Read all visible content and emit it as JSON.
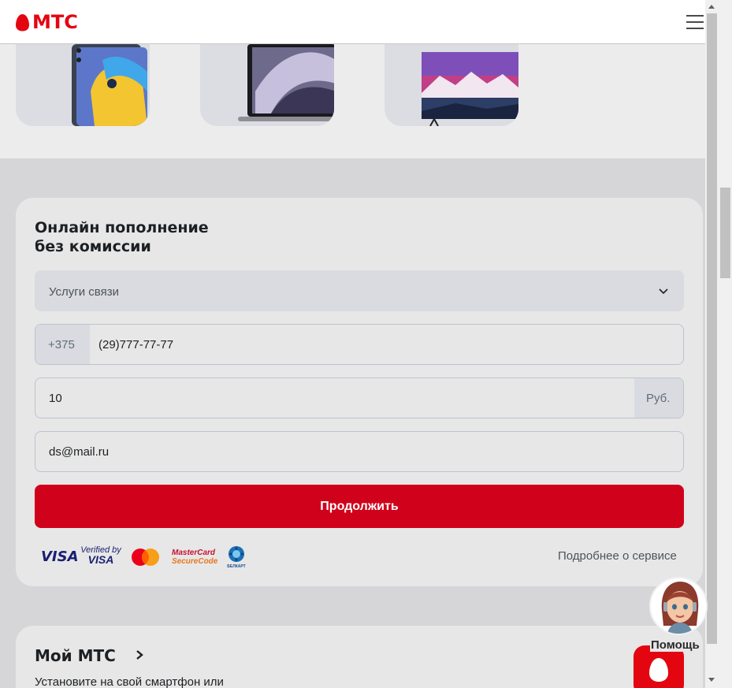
{
  "header": {
    "logo_text": "МТС",
    "menu_icon": "burger-menu-icon"
  },
  "products": [
    {
      "name": "tablet"
    },
    {
      "name": "laptop"
    },
    {
      "name": "tv"
    }
  ],
  "payment_form": {
    "title_line1": "Онлайн пополнение",
    "title_line2": "без комиссии",
    "service_select": {
      "value": "Услуги связи",
      "icon": "chevron-down-icon"
    },
    "phone": {
      "prefix": "+375",
      "value": "(29)777-77-77"
    },
    "amount": {
      "value": "10",
      "currency": "Руб."
    },
    "email": {
      "value": "ds@mail.ru"
    },
    "continue_label": "Продолжить",
    "payment_logos": {
      "visa": "VISA",
      "verified_by_line1": "Verified by",
      "verified_by_line2": "VISA",
      "mastercard_line1": "MasterCard",
      "mastercard_line2": "SecureCode",
      "belkart": "БЕЛКАРТ"
    },
    "more_link": "Подробнее о сервисе"
  },
  "my_mts": {
    "title": "Мой МТС",
    "text": "Установите на свой смартфон или"
  },
  "help": {
    "label": "Помощь"
  },
  "colors": {
    "brand_red": "#e30611",
    "button_red": "#d0021b"
  }
}
